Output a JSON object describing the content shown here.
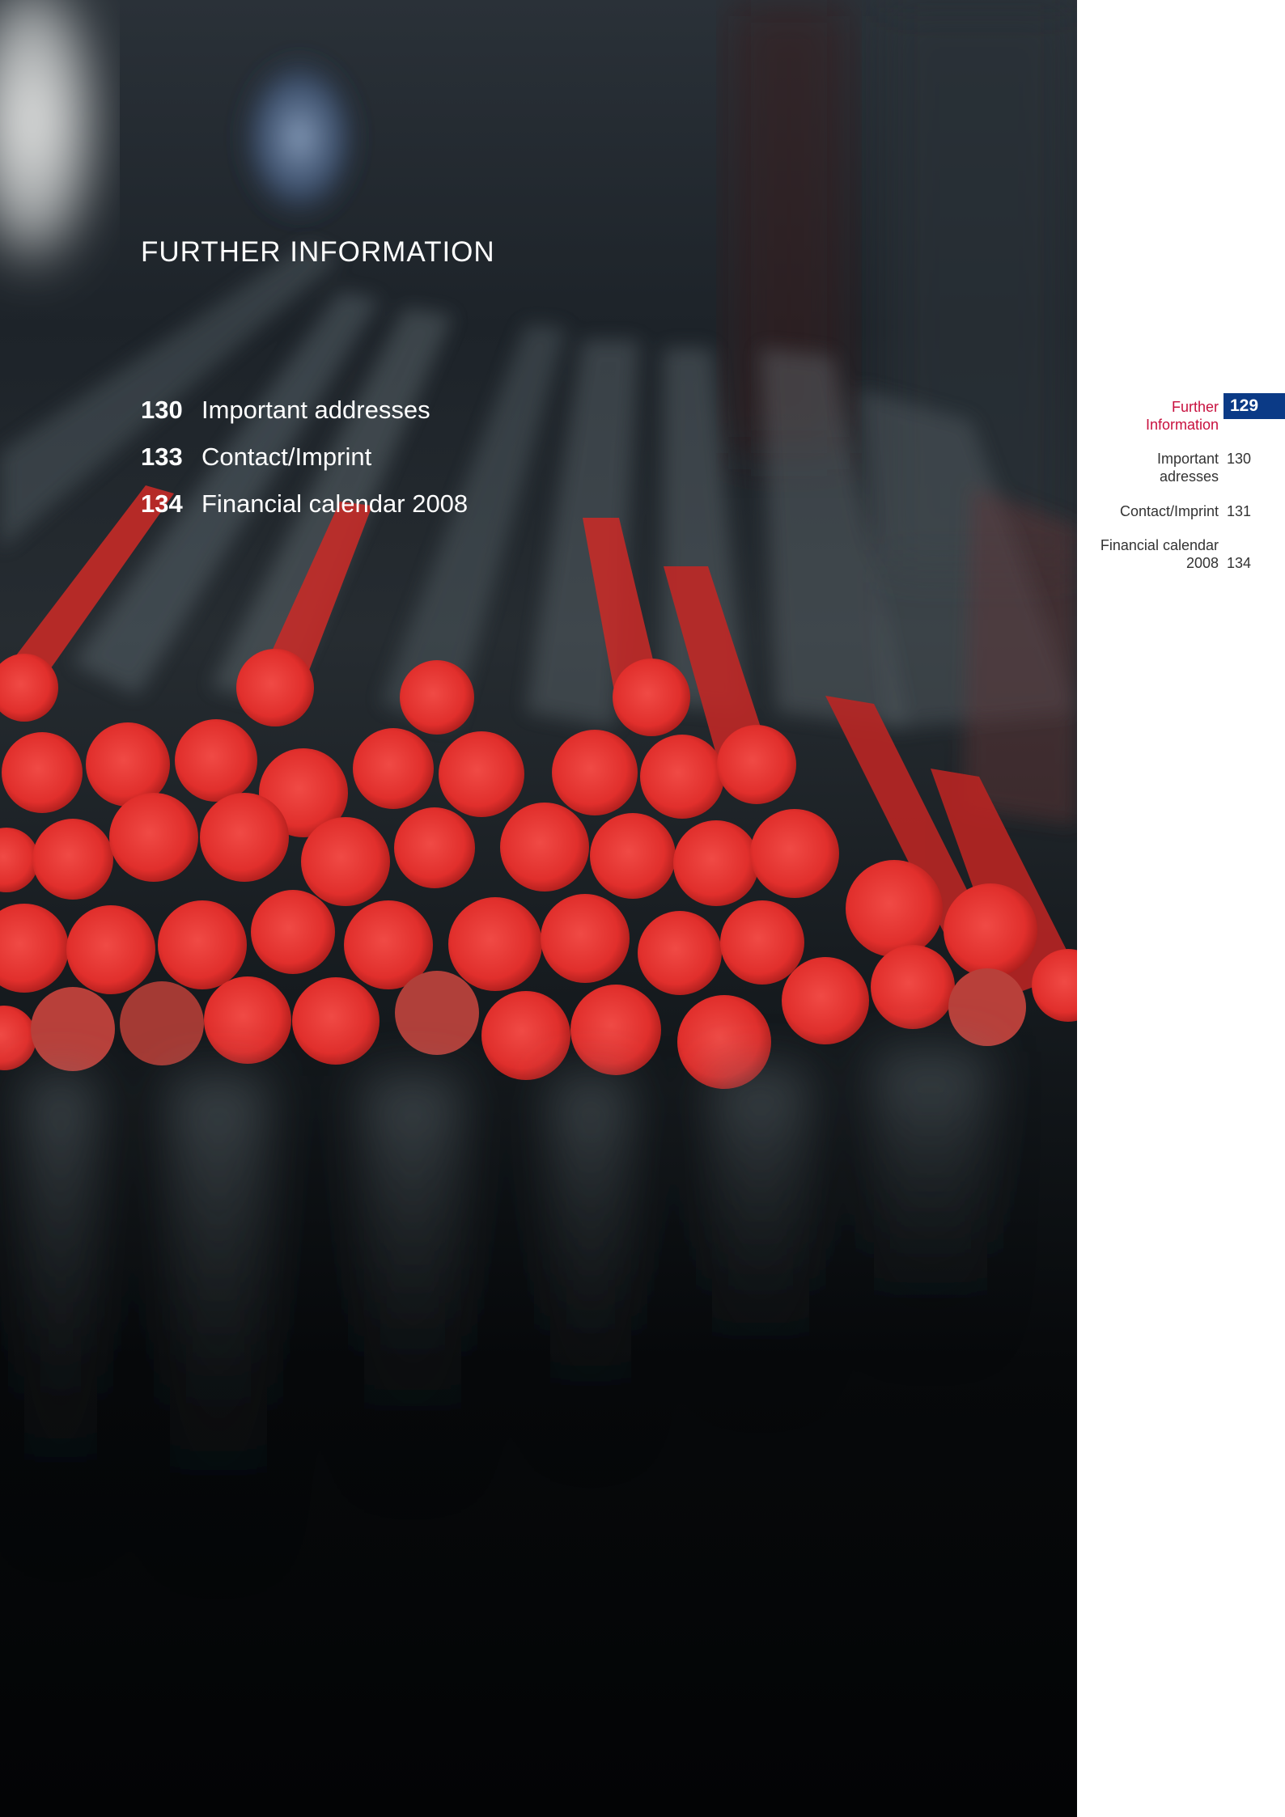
{
  "main": {
    "title": "FURTHER INFORMATION",
    "toc": [
      {
        "num": "130",
        "label": "Important addresses"
      },
      {
        "num": "133",
        "label": "Contact/Imprint"
      },
      {
        "num": "134",
        "label": "Financial calendar 2008"
      }
    ]
  },
  "sidebar": {
    "items": [
      {
        "label_line1": "Further",
        "label_line2": "Information",
        "page": "129"
      },
      {
        "label_line1": "Important",
        "label_line2": "adresses",
        "page": "130"
      },
      {
        "label_line1": "Contact/Imprint",
        "label_line2": "",
        "page": "131"
      },
      {
        "label_line1": "Financial calendar",
        "label_line2": "2008",
        "page": "134"
      }
    ]
  },
  "colors": {
    "accent_red": "#c8103e",
    "page_badge_blue": "#0b3a86",
    "rod_red": "#e12f2c"
  }
}
